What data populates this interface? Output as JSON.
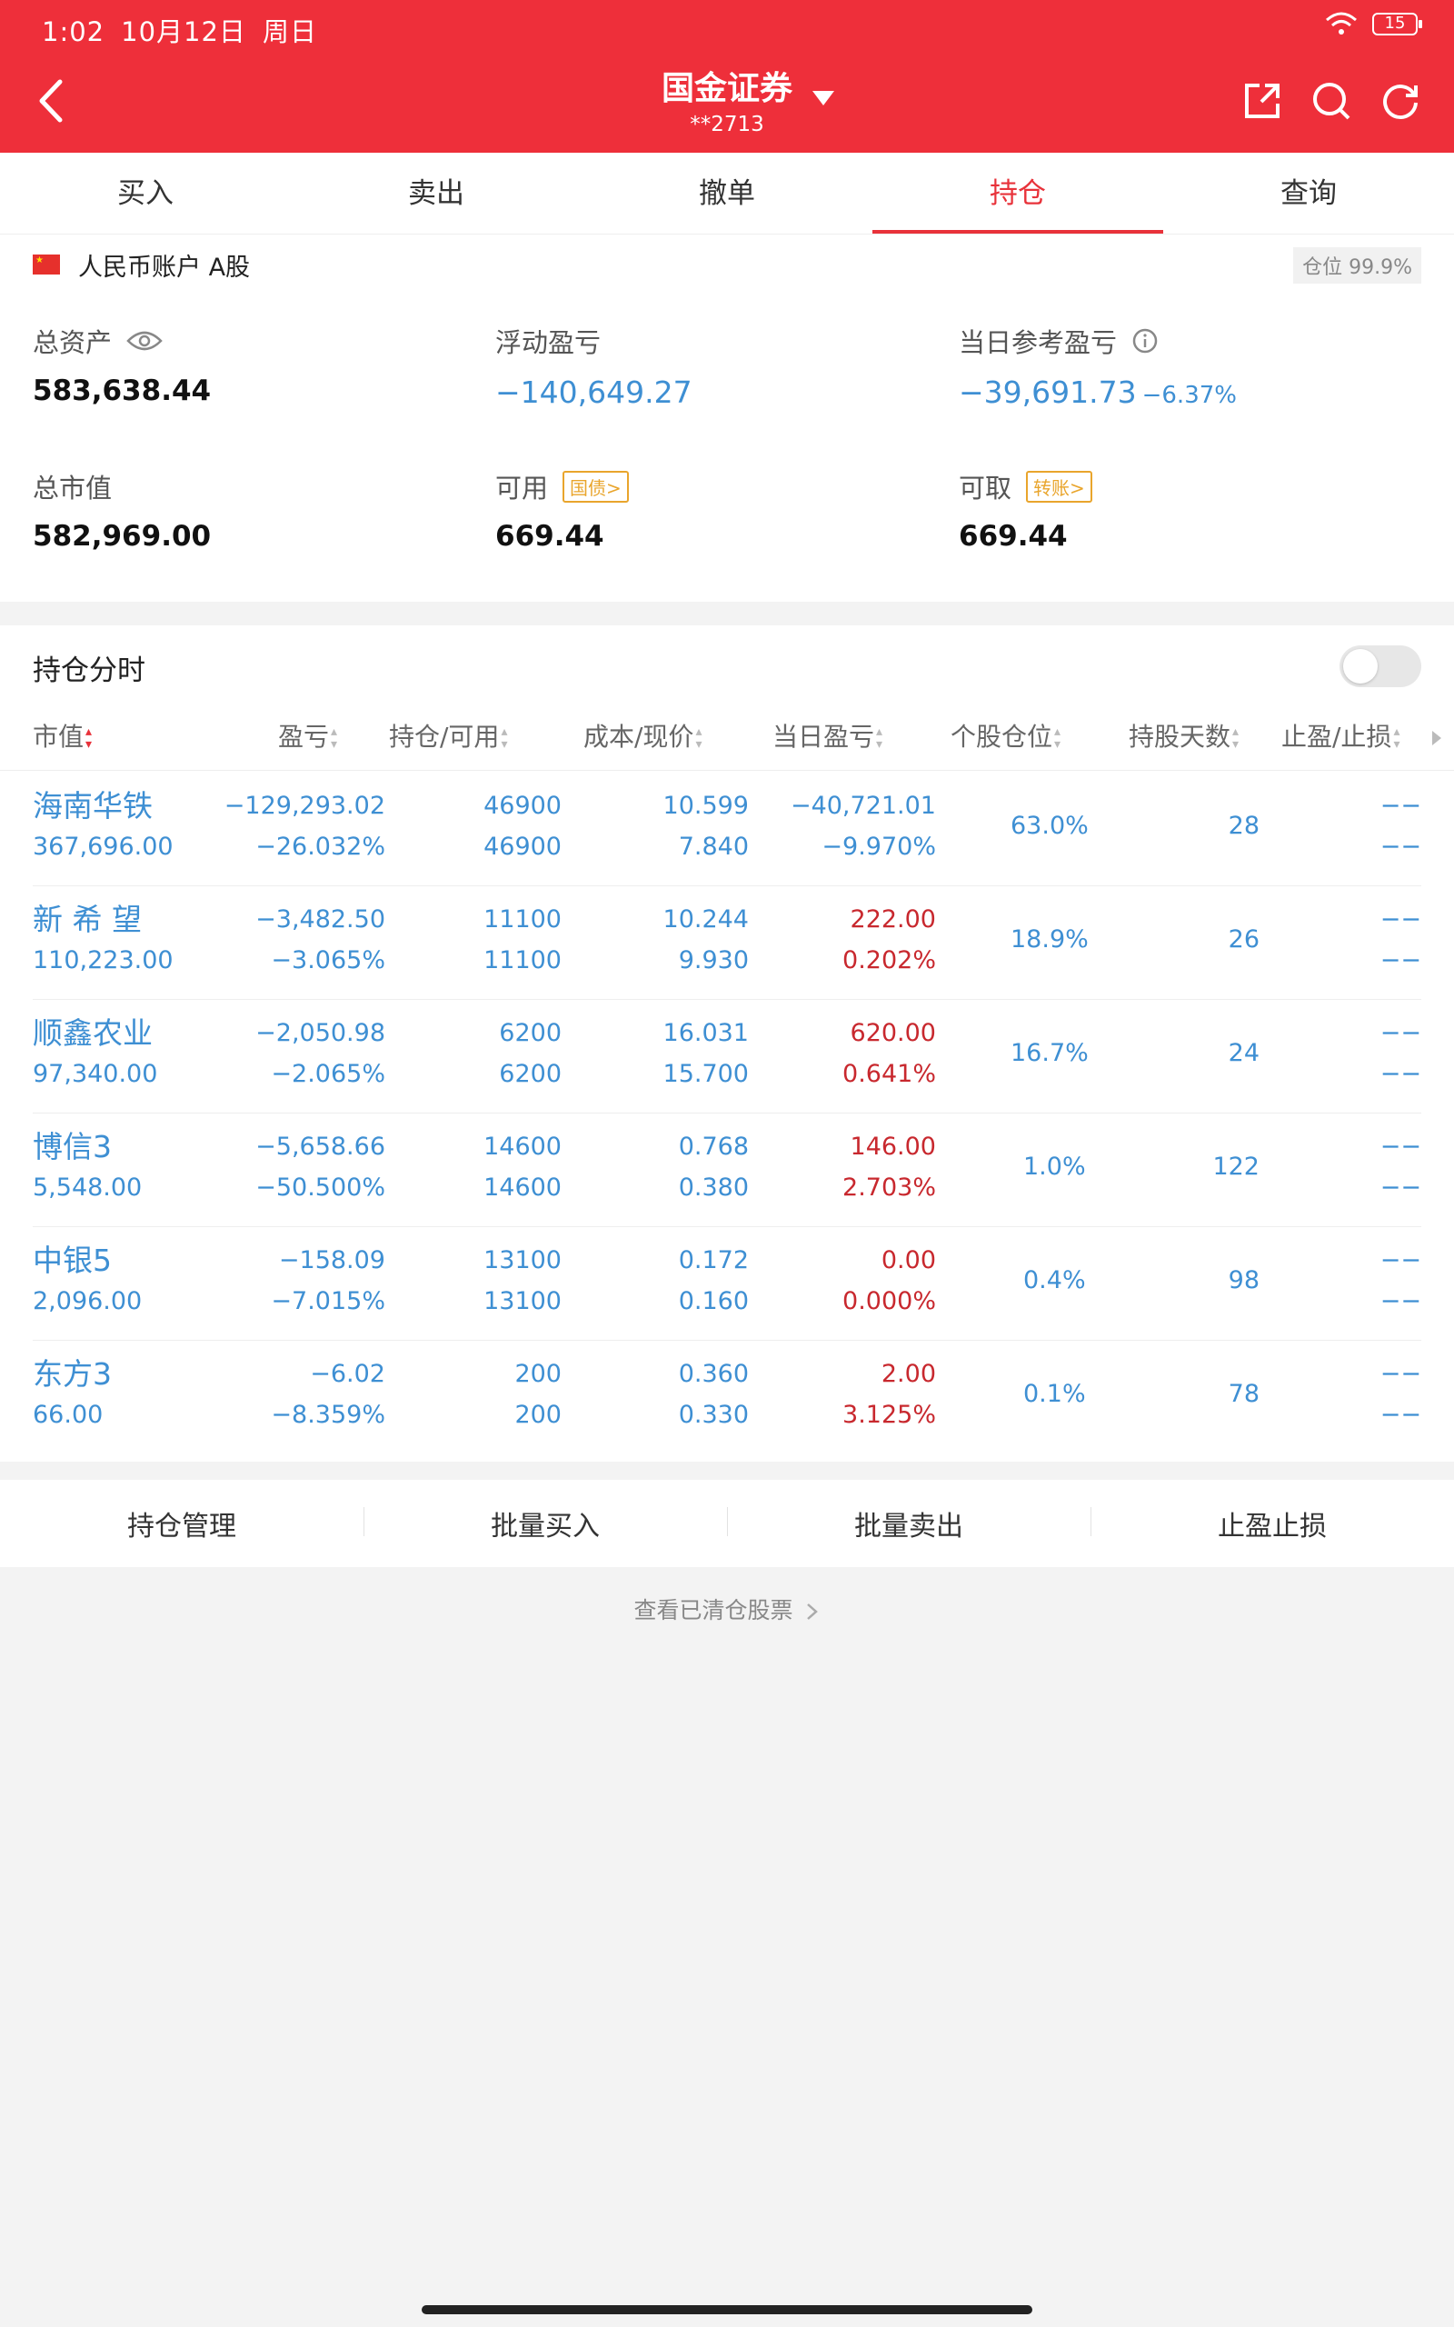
{
  "status": {
    "time": "1:02",
    "date": "10月12日",
    "weekday": "周日",
    "battery": "15"
  },
  "header": {
    "title": "国金证券",
    "account": "**2713"
  },
  "tabs": [
    "买入",
    "卖出",
    "撤单",
    "持仓",
    "查询"
  ],
  "account": {
    "label": "人民币账户 A股",
    "position_badge": "仓位 99.9%",
    "total_assets_label": "总资产",
    "total_assets": "583,638.44",
    "float_pnl_label": "浮动盈亏",
    "float_pnl": "−140,649.27",
    "day_pnl_label": "当日参考盈亏",
    "day_pnl": "−39,691.73",
    "day_pnl_pct": "−6.37%",
    "market_value_label": "总市值",
    "market_value": "582,969.00",
    "available_label": "可用",
    "available_tag": "国债>",
    "available": "669.44",
    "withdrawable_label": "可取",
    "withdrawable_tag": "转账>",
    "withdrawable": "669.44"
  },
  "holdings": {
    "title": "持仓分时",
    "columns": [
      "市值",
      "盈亏",
      "持仓/可用",
      "成本/现价",
      "当日盈亏",
      "个股仓位",
      "持股天数",
      "止盈/止损"
    ],
    "rows": [
      {
        "name": "海南华铁",
        "value": "367,696.00",
        "pnl": "−129,293.02",
        "pnl_pct": "−26.032%",
        "hold": "46900",
        "avail": "46900",
        "cost": "10.599",
        "price": "7.840",
        "day_pnl": "−40,721.01",
        "day_pct": "−9.970%",
        "weight": "63.0%",
        "days": "28",
        "stop1": "−−",
        "stop2": "−−"
      },
      {
        "name": "新 希 望",
        "value": "110,223.00",
        "pnl": "−3,482.50",
        "pnl_pct": "−3.065%",
        "hold": "11100",
        "avail": "11100",
        "cost": "10.244",
        "price": "9.930",
        "day_pnl": "222.00",
        "day_pct": "0.202%",
        "weight": "18.9%",
        "days": "26",
        "stop1": "−−",
        "stop2": "−−"
      },
      {
        "name": "顺鑫农业",
        "value": "97,340.00",
        "pnl": "−2,050.98",
        "pnl_pct": "−2.065%",
        "hold": "6200",
        "avail": "6200",
        "cost": "16.031",
        "price": "15.700",
        "day_pnl": "620.00",
        "day_pct": "0.641%",
        "weight": "16.7%",
        "days": "24",
        "stop1": "−−",
        "stop2": "−−"
      },
      {
        "name": "博信3",
        "value": "5,548.00",
        "pnl": "−5,658.66",
        "pnl_pct": "−50.500%",
        "hold": "14600",
        "avail": "14600",
        "cost": "0.768",
        "price": "0.380",
        "day_pnl": "146.00",
        "day_pct": "2.703%",
        "weight": "1.0%",
        "days": "122",
        "stop1": "−−",
        "stop2": "−−"
      },
      {
        "name": "中银5",
        "value": "2,096.00",
        "pnl": "−158.09",
        "pnl_pct": "−7.015%",
        "hold": "13100",
        "avail": "13100",
        "cost": "0.172",
        "price": "0.160",
        "day_pnl": "0.00",
        "day_pct": "0.000%",
        "weight": "0.4%",
        "days": "98",
        "stop1": "−−",
        "stop2": "−−"
      },
      {
        "name": "东方3",
        "value": "66.00",
        "pnl": "−6.02",
        "pnl_pct": "−8.359%",
        "hold": "200",
        "avail": "200",
        "cost": "0.360",
        "price": "0.330",
        "day_pnl": "2.00",
        "day_pct": "3.125%",
        "weight": "0.1%",
        "days": "78",
        "stop1": "−−",
        "stop2": "−−"
      }
    ]
  },
  "actions": [
    "持仓管理",
    "批量买入",
    "批量卖出",
    "止盈止损"
  ],
  "cleared_link": "查看已清仓股票",
  "colors": {
    "brand_red": "#ee2f3a",
    "loss_blue": "#3e8fd3",
    "gain_red": "#c8282e"
  }
}
